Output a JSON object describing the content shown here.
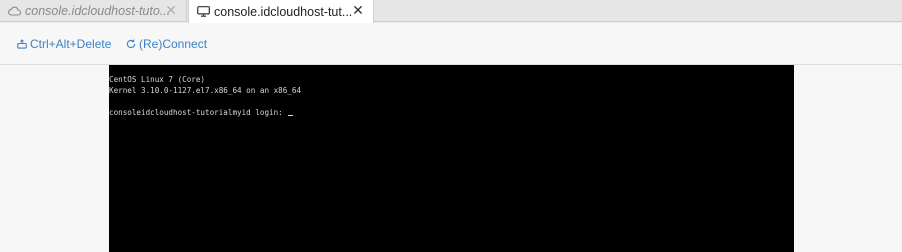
{
  "tabs": [
    {
      "label": "console.idcloudhost-tuto...",
      "icon": "cloud-icon",
      "active": false,
      "close": "✕"
    },
    {
      "label": "console.idcloudhost-tut...",
      "icon": "monitor-icon",
      "active": true,
      "close": "✕"
    }
  ],
  "toolbar": {
    "cad_label": "Ctrl+Alt+Delete",
    "cad_icon": "keyboard-icon",
    "reconnect_label": "(Re)Connect",
    "reconnect_icon": "refresh-icon"
  },
  "terminal": {
    "lines": [
      "CentOS Linux 7 (Core)",
      "Kernel 3.10.0-1127.el7.x86_64 on an x86_64",
      "",
      "consoleidcloudhost-tutorialmyid login: "
    ]
  },
  "colors": {
    "accent": "#3b82c4",
    "terminal_bg": "#000000",
    "terminal_fg": "#d8d8d8",
    "tabbar_bg": "#e6e6e6",
    "toolbar_bg": "#f7f7f7"
  }
}
